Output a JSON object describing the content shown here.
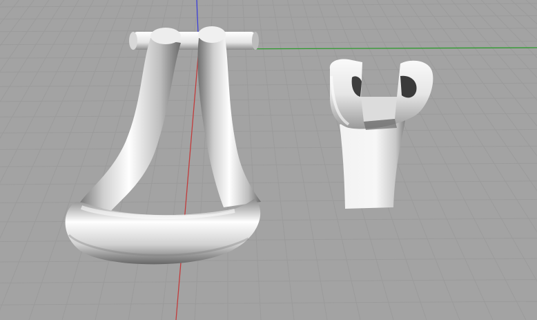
{
  "viewport": {
    "background_color": "#a3a3a3",
    "grid": {
      "visible": true,
      "line_color": "#9b9b9b",
      "major_line_color": "#939393"
    },
    "axes": {
      "x_axis_color": "#2f9a2f",
      "y_axis_color": "#c23b3b",
      "z_axis_color": "#3c3fd8"
    },
    "objects": [
      {
        "name": "stirrup-model",
        "material_color": "#e8e8e8"
      },
      {
        "name": "stirrup-hanger-model",
        "material_color": "#e8e8e8"
      }
    ]
  }
}
